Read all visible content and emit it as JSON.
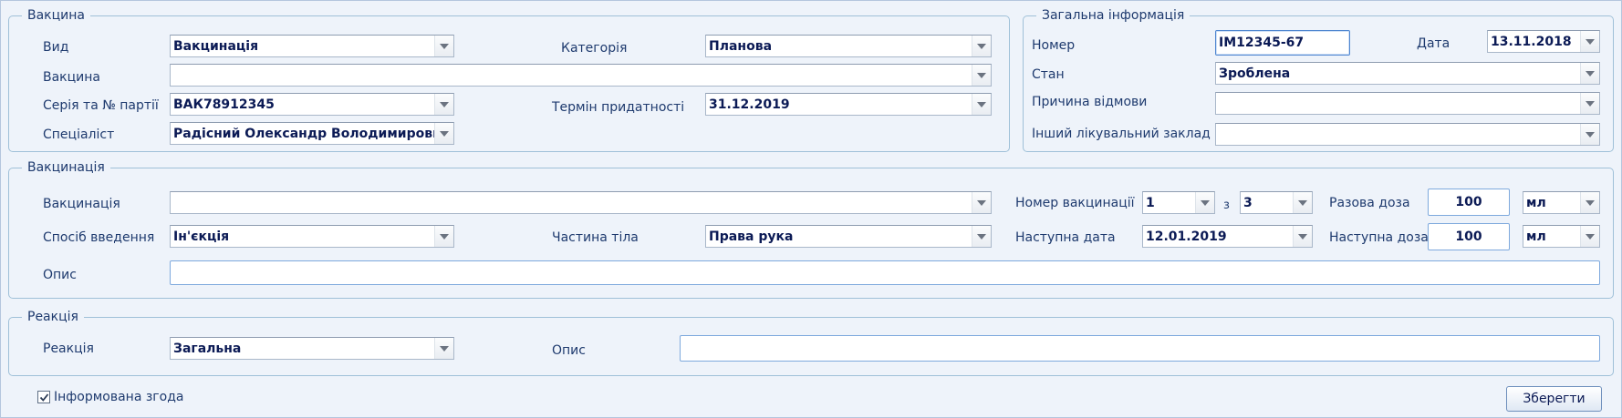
{
  "groups": {
    "vaccine": {
      "title": "Вакцина",
      "type_label": "Вид",
      "type_value": "Вакцинація",
      "category_label": "Категорія",
      "category_value": "Планова",
      "vaccine_label": "Вакцина",
      "vaccine_value": "",
      "series_label": "Серія та № партії",
      "series_value": "ВАК78912345",
      "expiry_label": "Термін придатності",
      "expiry_value": "31.12.2019",
      "specialist_label": "Спеціаліст",
      "specialist_value": "Радісний Олександр Володимирович"
    },
    "general": {
      "title": "Загальна інформація",
      "number_label": "Номер",
      "number_value": "ІМ12345-67",
      "date_label": "Дата",
      "date_value": "13.11.2018",
      "status_label": "Стан",
      "status_value": "Зроблена",
      "refusal_label": "Причина відмови",
      "refusal_value": "",
      "other_facility_label": "Інший лікувальний заклад",
      "other_facility_value": ""
    },
    "vaccination": {
      "title": "Вакцинація",
      "vaccination_label": "Вакцинація",
      "vaccination_value": "",
      "number_label": "Номер вакцинації",
      "number_value": "1",
      "of_label": "з",
      "of_value": "3",
      "single_dose_label": "Разова доза",
      "single_dose_value": "100",
      "single_dose_unit": "мл",
      "method_label": "Спосіб введення",
      "method_value": "Ін'єкція",
      "body_part_label": "Частина тіла",
      "body_part_value": "Права рука",
      "next_date_label": "Наступна дата",
      "next_date_value": "12.01.2019",
      "next_dose_label": "Наступна доза",
      "next_dose_value": "100",
      "next_dose_unit": "мл",
      "description_label": "Опис",
      "description_value": ""
    },
    "reaction": {
      "title": "Реакція",
      "reaction_label": "Реакція",
      "reaction_value": "Загальна",
      "description_label": "Опис",
      "description_value": ""
    }
  },
  "footer": {
    "consent_label": "Інформована згода",
    "consent_checked": true,
    "save_label": "Зберегти"
  }
}
